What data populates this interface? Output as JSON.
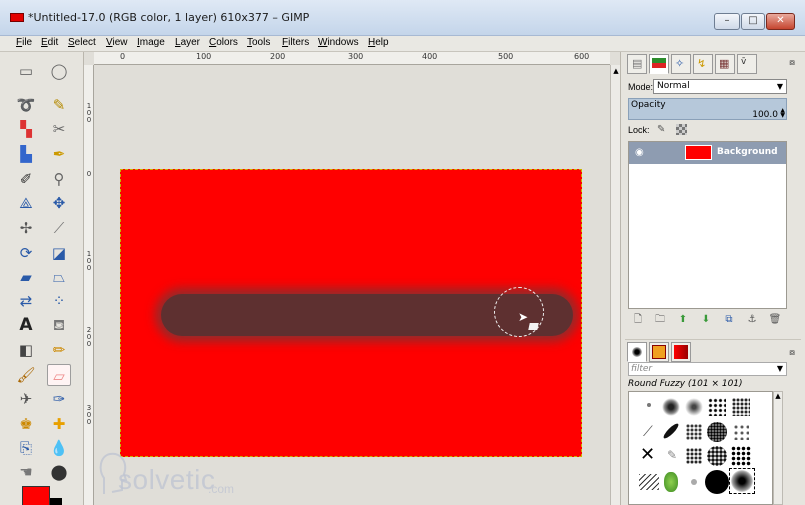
{
  "window": {
    "title": "*Untitled-17.0 (RGB color, 1 layer) 610x377 – GIMP",
    "minimize": "–",
    "maximize": "□",
    "close": "✕"
  },
  "menu": [
    {
      "u": "F",
      "rest": "ile"
    },
    {
      "u": "E",
      "rest": "dit"
    },
    {
      "u": "S",
      "rest": "elect"
    },
    {
      "u": "V",
      "rest": "iew"
    },
    {
      "u": "I",
      "rest": "mage"
    },
    {
      "u": "L",
      "rest": "ayer"
    },
    {
      "u": "C",
      "rest": "olors"
    },
    {
      "u": "T",
      "rest": "ools"
    },
    {
      "u": "F",
      "rest": "ilters"
    },
    {
      "u": "W",
      "rest": "indows"
    },
    {
      "u": "H",
      "rest": "elp"
    }
  ],
  "ruler": {
    "h_labels": [
      "0",
      "100",
      "200",
      "300",
      "400",
      "500",
      "600"
    ],
    "v_labels": [
      "1 0 0",
      "0",
      "1 0 0",
      "2 0 0",
      "3 0 0"
    ]
  },
  "tools": [
    "rect-select",
    "ellipse-select",
    "free-select",
    "fuzzy-select",
    "color-select",
    "scissors-select",
    "foreground-select",
    "paths",
    "color-picker",
    "zoom",
    "measure",
    "move",
    "align",
    "crop",
    "rotate",
    "scale",
    "shear",
    "perspective",
    "flip",
    "cage-transform",
    "text",
    "bucket-fill",
    "blend",
    "pencil",
    "paintbrush",
    "eraser",
    "airbrush",
    "ink",
    "clone",
    "heal",
    "perspective-clone",
    "blur",
    "smudge",
    "dodge-burn"
  ],
  "canvas": {
    "image_color": "#ff0000",
    "stroke_color": "#5e3030"
  },
  "watermark": {
    "text": "solvetic",
    "suffix": ".com"
  },
  "layers_panel": {
    "mode_label": "Mode:",
    "mode_value": "Normal",
    "opacity_label": "Opacity",
    "opacity_value": "100.0",
    "lock_label": "Lock:",
    "layers": [
      {
        "name": "Background",
        "color": "#ff0000",
        "visible": true
      }
    ]
  },
  "brushes_panel": {
    "filter_placeholder": "filter",
    "brush_name": "Round Fuzzy (101 × 101)"
  },
  "dock_close": "⧇"
}
